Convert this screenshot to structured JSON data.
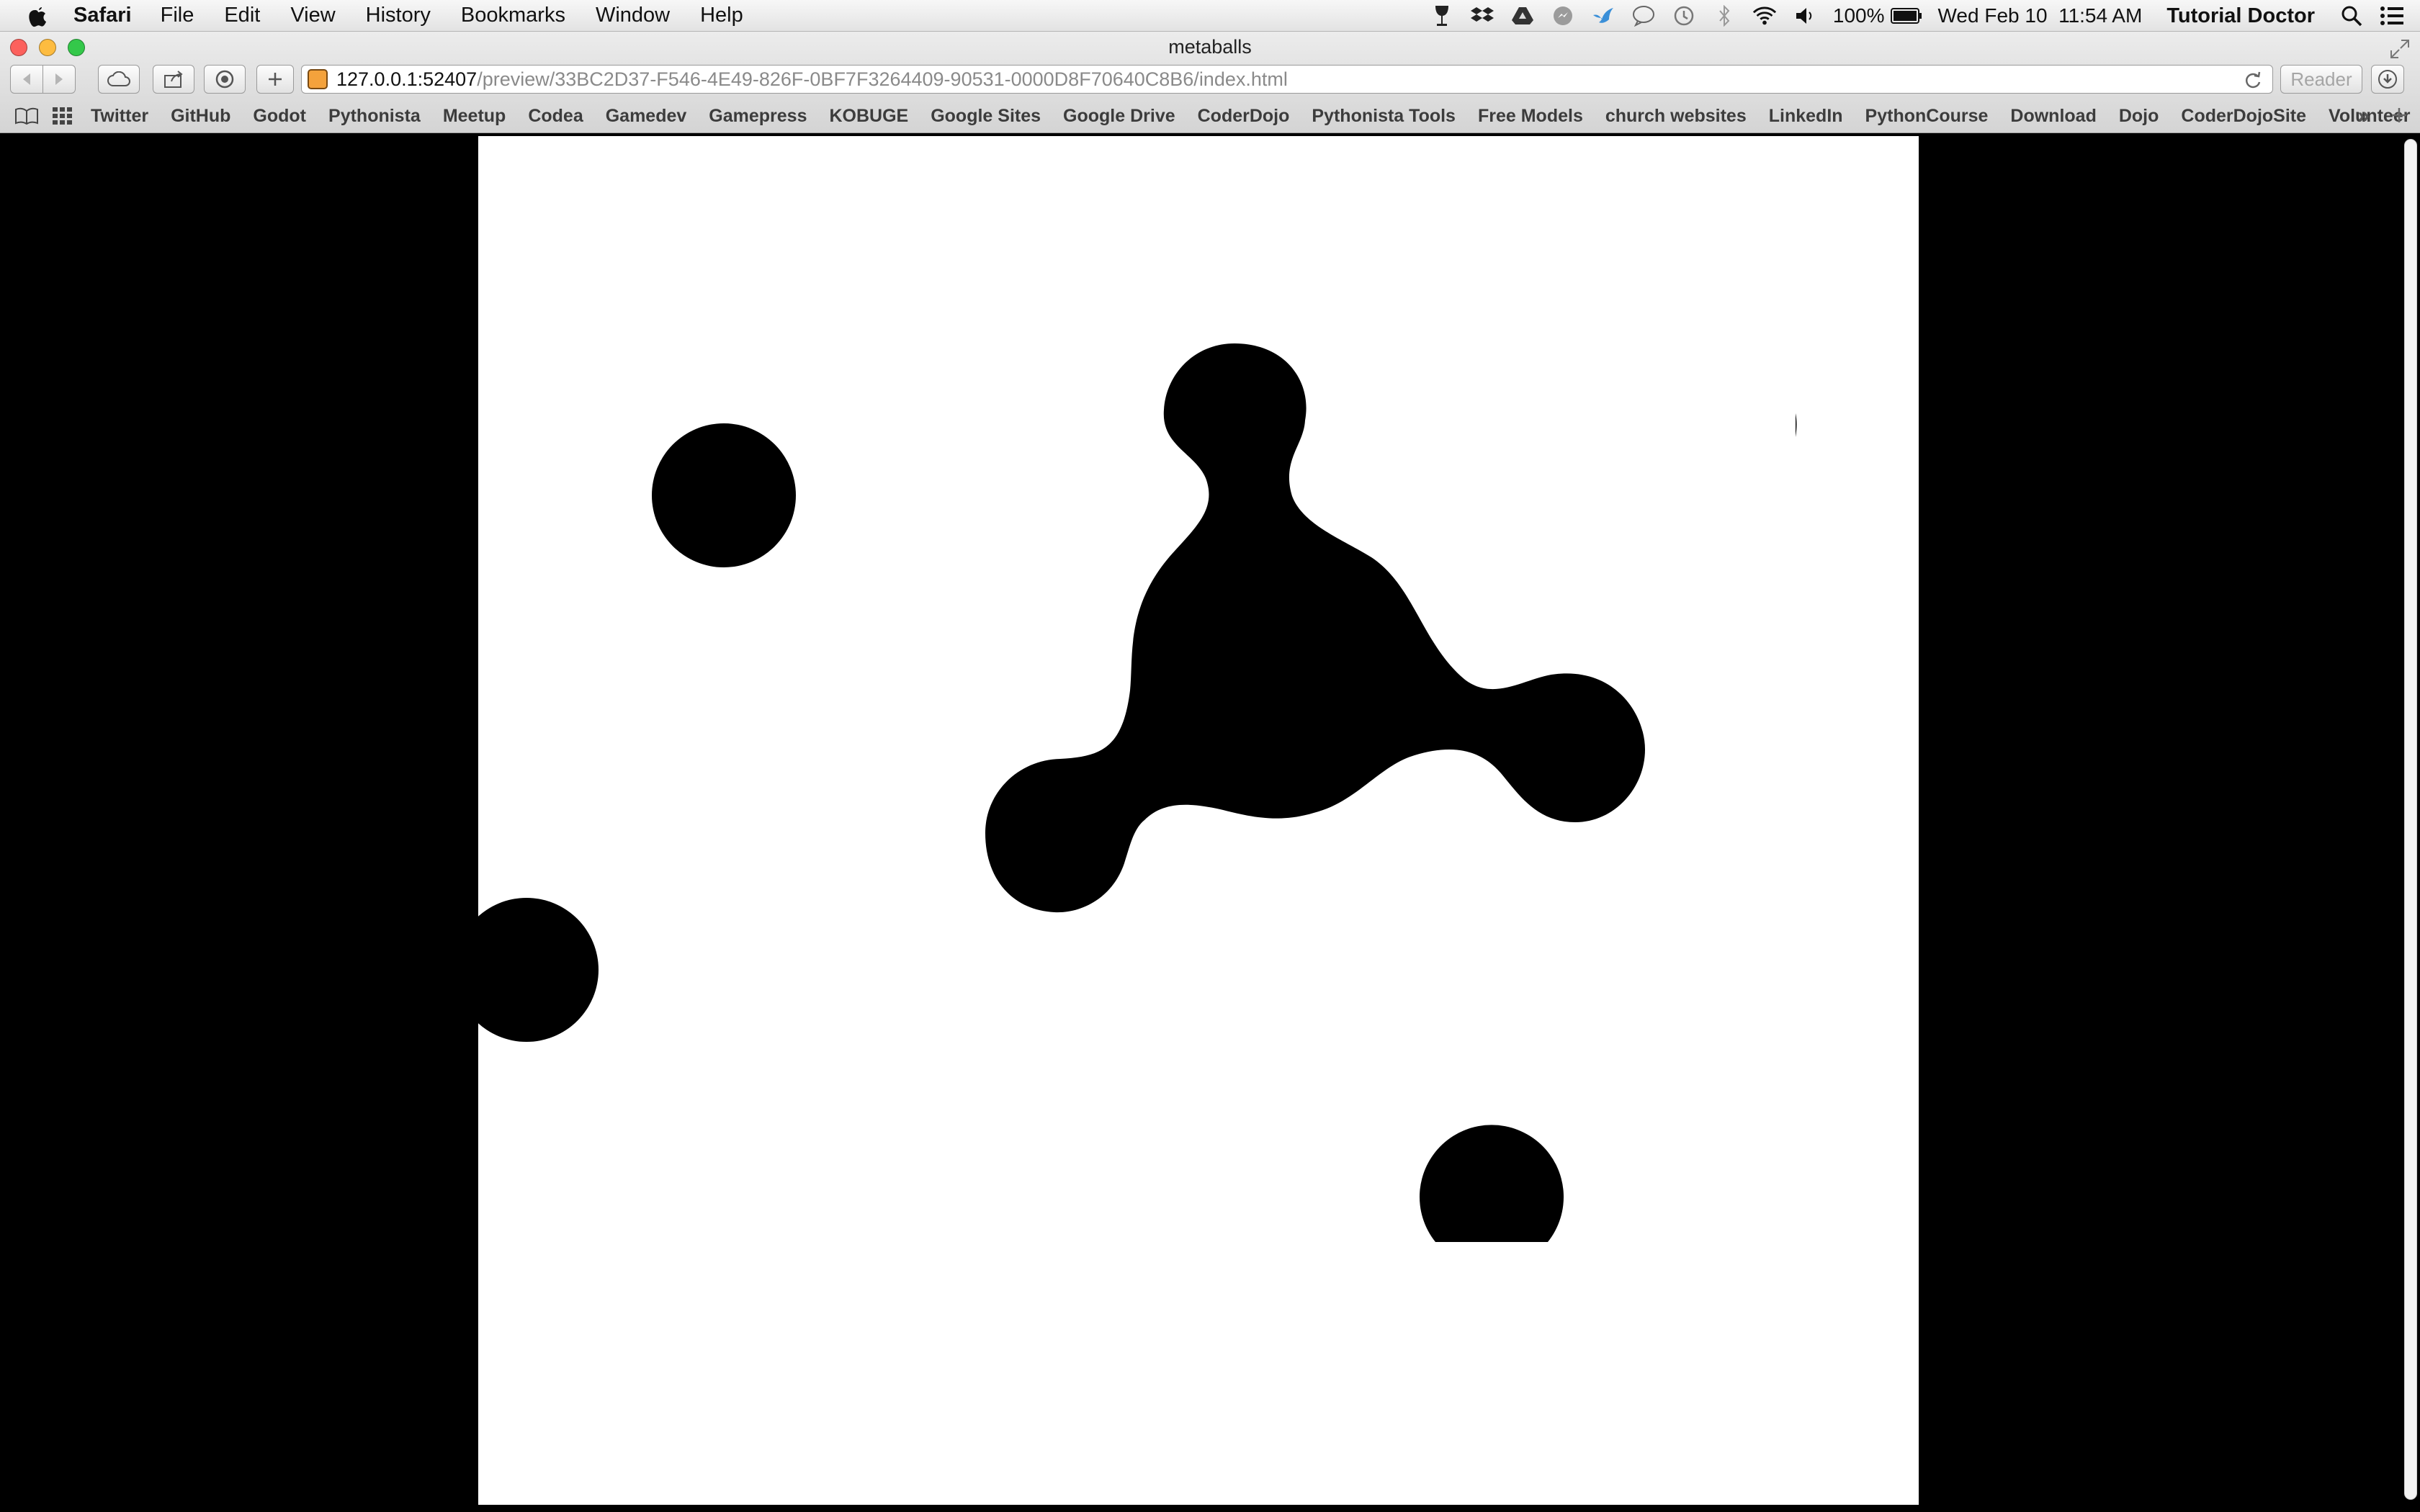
{
  "menubar": {
    "app_name": "Safari",
    "items": [
      "File",
      "Edit",
      "View",
      "History",
      "Bookmarks",
      "Window",
      "Help"
    ],
    "battery": "100%",
    "clock": "Wed Feb 10  11:54 AM",
    "user": "Tutorial Doctor",
    "status_icons": [
      "wine-glass-icon",
      "dropbox-icon",
      "google-drive-icon",
      "messenger-icon",
      "bird-icon",
      "chat-icon",
      "time-machine-icon",
      "bluetooth-icon",
      "wifi-icon",
      "volume-icon",
      "battery-icon"
    ]
  },
  "window": {
    "title": "metaballs"
  },
  "toolbar": {
    "url_host": "127.0.0.1:52407",
    "url_path": "/preview/33BC2D37-F546-4E49-826F-0BF7F3264409-90531-0000D8F70640C8B6/index.html",
    "reader_label": "Reader"
  },
  "bookmarks": {
    "items": [
      "Twitter",
      "GitHub",
      "Godot",
      "Pythonista",
      "Meetup",
      "Codea",
      "Gamedev",
      "Gamepress",
      "KOBUGE",
      "Google Sites",
      "Google Drive",
      "CoderDojo",
      "Pythonista Tools",
      "Free Models",
      "church websites",
      "LinkedIn",
      "PythonCourse",
      "Download",
      "Dojo",
      "CoderDojoSite",
      "Volunteer"
    ],
    "more_label": "»"
  },
  "colors": {
    "blob": "#000000",
    "canvas": "#ffffff",
    "close": "#fc615d",
    "minimize": "#fdbc40",
    "zoom": "#34c84a"
  }
}
